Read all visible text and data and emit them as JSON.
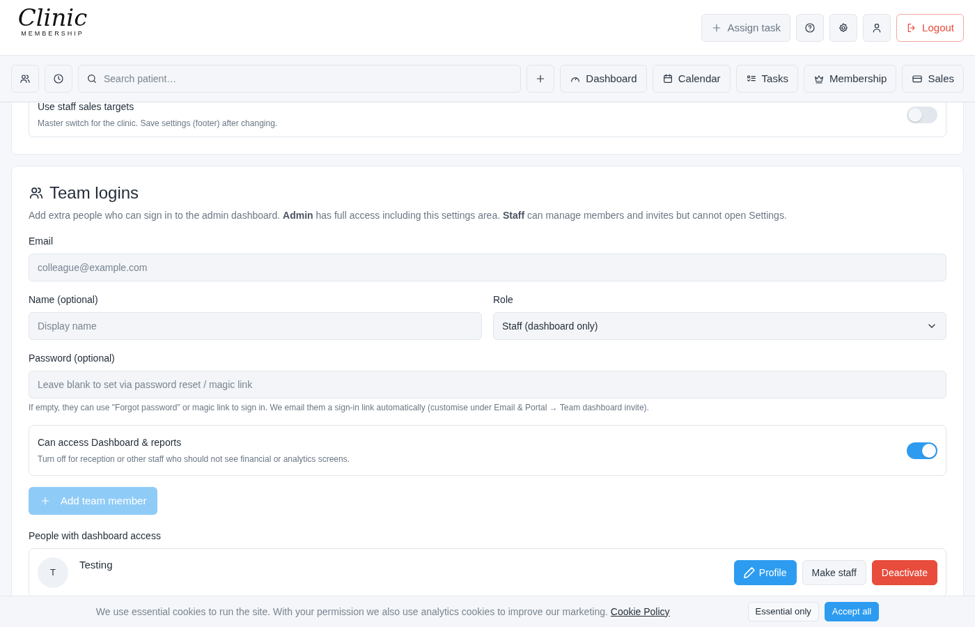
{
  "header": {
    "logo": {
      "title": "Clinic",
      "subtitle": "MEMBERSHIP"
    },
    "actions": [
      {
        "kind": "ghost",
        "label": "Assign task"
      },
      {
        "kind": "danger",
        "label": "Logout"
      }
    ]
  },
  "toolbar": {
    "search": {
      "placeholder": "Search patient…"
    },
    "nav": [
      {
        "label": "Dashboard"
      },
      {
        "label": "Calendar"
      },
      {
        "label": "Tasks"
      },
      {
        "label": "Membership"
      },
      {
        "label": "Sales"
      }
    ]
  },
  "sales_card": {
    "toggle": {
      "title": "Use staff sales targets",
      "hint": "Master switch for the clinic. Save settings (footer) after changing.",
      "on": false
    }
  },
  "team": {
    "title": "Team logins",
    "description": "Add extra people who can sign in to the admin dashboard. **Admin** has full access including this settings area. **Staff** can manage members and invites but cannot open Settings.",
    "email": {
      "label": "Email",
      "placeholder": "colleague@example.com"
    },
    "name": {
      "label": "Name (optional)",
      "placeholder": "Display name"
    },
    "role": {
      "label": "Role",
      "value": "Staff (dashboard only)"
    },
    "password": {
      "label": "Password (optional)",
      "placeholder": "Leave blank to set via password reset / magic link",
      "help": "If empty, they can use \"Forgot password\" or magic link to sign in. We email them a sign-in link automatically (customise under Email & Portal → Team dashboard invite)."
    },
    "access_toggle": {
      "title": "Can access Dashboard & reports",
      "hint": "Turn off for reception or other staff who should not see financial or analytics screens.",
      "on": true
    },
    "add_button": {
      "label": "Add team member",
      "disabled": true
    },
    "list_title": "People with dashboard access",
    "people": [
      {
        "initial": "T",
        "name": "Testing",
        "actions": [
          {
            "kind": "primary",
            "label": "Profile"
          },
          {
            "kind": "light",
            "label": "Make staff"
          },
          {
            "kind": "danger",
            "label": "Deactivate"
          }
        ]
      }
    ]
  },
  "cookie": {
    "text": "We use essential cookies to run the site. With your permission we also use analytics cookies to improve our marketing.",
    "link": "Cookie Policy",
    "buttons": [
      {
        "kind": "light",
        "label": "Essential only"
      },
      {
        "kind": "primary",
        "label": "Accept all"
      }
    ]
  }
}
